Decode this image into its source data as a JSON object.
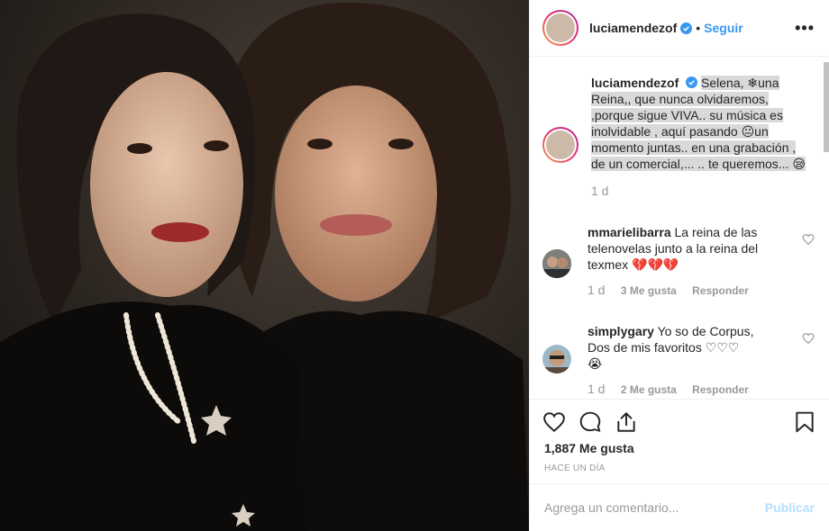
{
  "header": {
    "username": "luciamendezof",
    "separator": "•",
    "follow_label": "Seguir",
    "more_label": "•••"
  },
  "caption": {
    "username": "luciamendezof",
    "lines": [
      "Selena, ❄una",
      "Reina,, que nunca olvidaremos,",
      ",porque sigue VIVA.. su música es",
      "inolvidable , aquí pasando 😐un",
      "momento juntas.. en una grabación ,",
      "de un comercial,... .. te queremos... 😪"
    ],
    "time": "1 d"
  },
  "comments": [
    {
      "username": "mmarielibarra",
      "text_lines": [
        "La reina de las",
        "telenovelas junto a la reina del",
        "texmex 💔💔💔"
      ],
      "time": "1 d",
      "likes": "3 Me gusta",
      "reply": "Responder"
    },
    {
      "username": "simplygary",
      "text_lines": [
        "Yo so de Corpus,",
        "Dos de mis favoritos ♡♡♡",
        "😭"
      ],
      "time": "1 d",
      "likes": "2 Me gusta",
      "reply": "Responder"
    }
  ],
  "likes_count": "1,887 Me gusta",
  "posted_time": "HACE UN DÍA",
  "add_comment": {
    "placeholder": "Agrega un comentario...",
    "publish_label": "Publicar"
  },
  "colors": {
    "link": "#3897f0",
    "verified": "#3897f0",
    "publish_disabled": "#b2dffc"
  }
}
